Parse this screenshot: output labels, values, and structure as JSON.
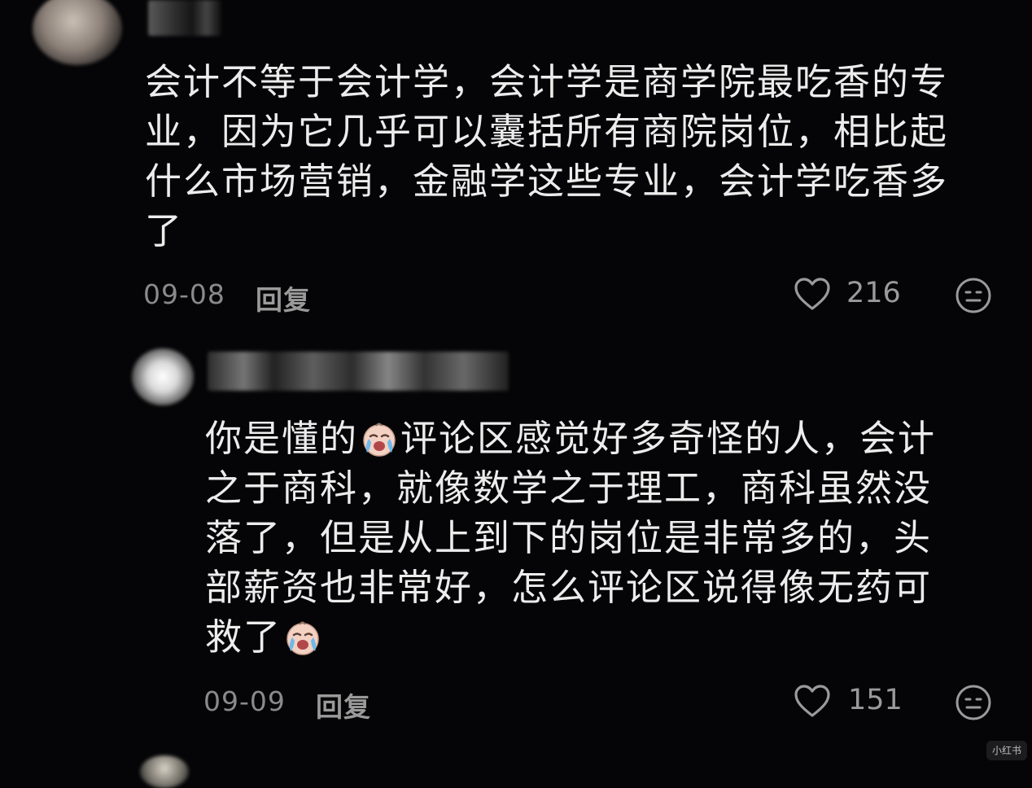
{
  "comments": [
    {
      "lines": [
        "会计不等于会计学，会计学是商学院最吃香的专",
        "业，因为它几乎可以囊括所有商院岗位，相比起",
        "什么市场营销，金融学这些专业，会计学吃香多",
        "了"
      ],
      "date": "09-08",
      "reply_label": "回复",
      "likes": "216"
    },
    {
      "line1_before_emoji": "你是懂的",
      "line1_after_emoji": "评论区感觉好多奇怪的人，会计",
      "lines_middle": [
        "之于商科，就像数学之于理工，商科虽然没",
        "落了，但是从上到下的岗位是非常多的，头",
        "部薪资也非常好，怎么评论区说得像无药可"
      ],
      "last_line_text": "救了",
      "emoji_name": "crying-face-emoji",
      "date": "09-09",
      "reply_label": "回复",
      "likes": "151"
    }
  ],
  "icons": {
    "like": "heart-outline-icon",
    "reaction": "neutral-face-icon"
  },
  "watermark": "小红书",
  "colors": {
    "background": "#050507",
    "text": "#ececec",
    "meta": "#8a8a8a"
  }
}
